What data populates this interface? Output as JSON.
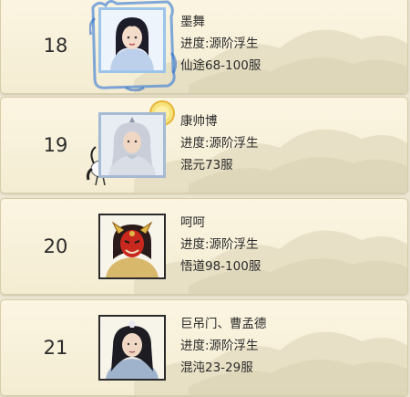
{
  "rows": [
    {
      "rank": "18",
      "name": "墨舞",
      "progress": "进度:源阶浮生",
      "server": "仙途68-100服"
    },
    {
      "rank": "19",
      "name": "康帅博",
      "progress": "进度:源阶浮生",
      "server": "混元73服"
    },
    {
      "rank": "20",
      "name": "呵呵",
      "progress": "进度:源阶浮生",
      "server": "悟道98-100服"
    },
    {
      "rank": "21",
      "name": "巨吊门、曹孟德",
      "progress": "进度:源阶浮生",
      "server": "混沌23-29服"
    }
  ]
}
